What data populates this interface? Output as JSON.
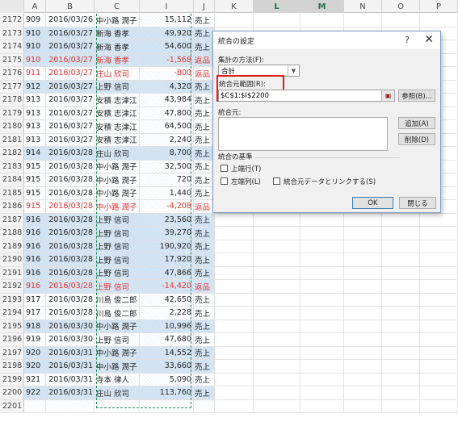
{
  "columns": [
    "A",
    "B",
    "C",
    "I",
    "J",
    "K",
    "L",
    "M",
    "N",
    "O",
    "P"
  ],
  "selected_columns": [
    "L",
    "M"
  ],
  "rows": [
    {
      "n": "2172",
      "a": "909",
      "b": "2016/03/26",
      "c": "中小路 潤子",
      "i": "15,112",
      "j": "売上",
      "hl": false,
      "red": false
    },
    {
      "n": "2173",
      "a": "910",
      "b": "2016/03/27",
      "c": "新海 香孝",
      "i": "49,920",
      "j": "売上",
      "hl": true,
      "red": false
    },
    {
      "n": "2174",
      "a": "910",
      "b": "2016/03/27",
      "c": "新海 香孝",
      "i": "54,600",
      "j": "売上",
      "hl": true,
      "red": false
    },
    {
      "n": "2175",
      "a": "910",
      "b": "2016/03/27",
      "c": "新海 香孝",
      "i": "-1,568",
      "j": "返品",
      "hl": true,
      "red": true
    },
    {
      "n": "2176",
      "a": "911",
      "b": "2016/03/27",
      "c": "庄山 欣司",
      "i": "-800",
      "j": "返品",
      "hl": false,
      "red": true
    },
    {
      "n": "2177",
      "a": "912",
      "b": "2016/03/27",
      "c": "上野 信司",
      "i": "4,320",
      "j": "売上",
      "hl": true,
      "red": false
    },
    {
      "n": "2178",
      "a": "913",
      "b": "2016/03/27",
      "c": "安積 志津江",
      "i": "43,984",
      "j": "売上",
      "hl": false,
      "red": false
    },
    {
      "n": "2179",
      "a": "913",
      "b": "2016/03/27",
      "c": "安積 志津江",
      "i": "47,800",
      "j": "売上",
      "hl": false,
      "red": false
    },
    {
      "n": "2180",
      "a": "913",
      "b": "2016/03/27",
      "c": "安積 志津江",
      "i": "64,500",
      "j": "売上",
      "hl": false,
      "red": false
    },
    {
      "n": "2181",
      "a": "913",
      "b": "2016/03/27",
      "c": "安積 志津江",
      "i": "2,240",
      "j": "売上",
      "hl": false,
      "red": false
    },
    {
      "n": "2182",
      "a": "914",
      "b": "2016/03/28",
      "c": "庄山 欣司",
      "i": "8,700",
      "j": "売上",
      "hl": true,
      "red": false
    },
    {
      "n": "2183",
      "a": "915",
      "b": "2016/03/28",
      "c": "中小路 潤子",
      "i": "32,500",
      "j": "売上",
      "hl": false,
      "red": false
    },
    {
      "n": "2184",
      "a": "915",
      "b": "2016/03/28",
      "c": "中小路 潤子",
      "i": "720",
      "j": "売上",
      "hl": false,
      "red": false
    },
    {
      "n": "2185",
      "a": "915",
      "b": "2016/03/28",
      "c": "中小路 潤子",
      "i": "1,440",
      "j": "売上",
      "hl": false,
      "red": false
    },
    {
      "n": "2186",
      "a": "915",
      "b": "2016/03/28",
      "c": "中小路 潤子",
      "i": "-4,208",
      "j": "返品",
      "hl": false,
      "red": true
    },
    {
      "n": "2187",
      "a": "916",
      "b": "2016/03/28",
      "c": "上野 信司",
      "i": "23,560",
      "j": "売上",
      "hl": true,
      "red": false
    },
    {
      "n": "2188",
      "a": "916",
      "b": "2016/03/28",
      "c": "上野 信司",
      "i": "39,270",
      "j": "売上",
      "hl": true,
      "red": false
    },
    {
      "n": "2189",
      "a": "916",
      "b": "2016/03/28",
      "c": "上野 信司",
      "i": "190,920",
      "j": "売上",
      "hl": true,
      "red": false
    },
    {
      "n": "2190",
      "a": "916",
      "b": "2016/03/28",
      "c": "上野 信司",
      "i": "17,920",
      "j": "売上",
      "hl": true,
      "red": false
    },
    {
      "n": "2191",
      "a": "916",
      "b": "2016/03/28",
      "c": "上野 信司",
      "i": "47,866",
      "j": "売上",
      "hl": true,
      "red": false
    },
    {
      "n": "2192",
      "a": "916",
      "b": "2016/03/28",
      "c": "上野 信司",
      "i": "-14,420",
      "j": "返品",
      "hl": true,
      "red": true
    },
    {
      "n": "2193",
      "a": "917",
      "b": "2016/03/28",
      "c": "川島 俊二郎",
      "i": "42,650",
      "j": "売上",
      "hl": false,
      "red": false
    },
    {
      "n": "2194",
      "a": "917",
      "b": "2016/03/28",
      "c": "川島 俊二郎",
      "i": "2,228",
      "j": "売上",
      "hl": false,
      "red": false
    },
    {
      "n": "2195",
      "a": "918",
      "b": "2016/03/30",
      "c": "中小路 潤子",
      "i": "10,996",
      "j": "売上",
      "hl": true,
      "red": false
    },
    {
      "n": "2196",
      "a": "919",
      "b": "2016/03/30",
      "c": "上野 信司",
      "i": "47,680",
      "j": "売上",
      "hl": false,
      "red": false
    },
    {
      "n": "2197",
      "a": "920",
      "b": "2016/03/31",
      "c": "中小路 潤子",
      "i": "14,552",
      "j": "売上",
      "hl": true,
      "red": false
    },
    {
      "n": "2198",
      "a": "920",
      "b": "2016/03/31",
      "c": "中小路 潤子",
      "i": "33,660",
      "j": "売上",
      "hl": true,
      "red": false
    },
    {
      "n": "2199",
      "a": "921",
      "b": "2016/03/31",
      "c": "寺本 律人",
      "i": "5,090",
      "j": "売上",
      "hl": false,
      "red": false
    },
    {
      "n": "2200",
      "a": "922",
      "b": "2016/03/31",
      "c": "庄山 欣司",
      "i": "113,760",
      "j": "売上",
      "hl": true,
      "red": false
    },
    {
      "n": "2201",
      "a": "",
      "b": "",
      "c": "",
      "i": "",
      "j": "",
      "hl": false,
      "red": false
    }
  ],
  "dialog": {
    "title": "統合の設定",
    "help": "?",
    "close": "✕",
    "function_label": "集計の方法(F):",
    "function_value": "合計",
    "reference_label": "統合元範囲(R):",
    "reference_value": "$C$1:$I$2200",
    "browse_button": "参照(B)...",
    "all_references_label": "統合元:",
    "add_button": "追加(A)",
    "delete_button": "削除(D)",
    "labels_group": "統合の基準",
    "top_row_label": "上端行(T)",
    "left_column_label": "左端列(L)",
    "link_label": "統合元データとリンクする(S)",
    "ok_button": "OK",
    "close_button": "閉じる"
  }
}
